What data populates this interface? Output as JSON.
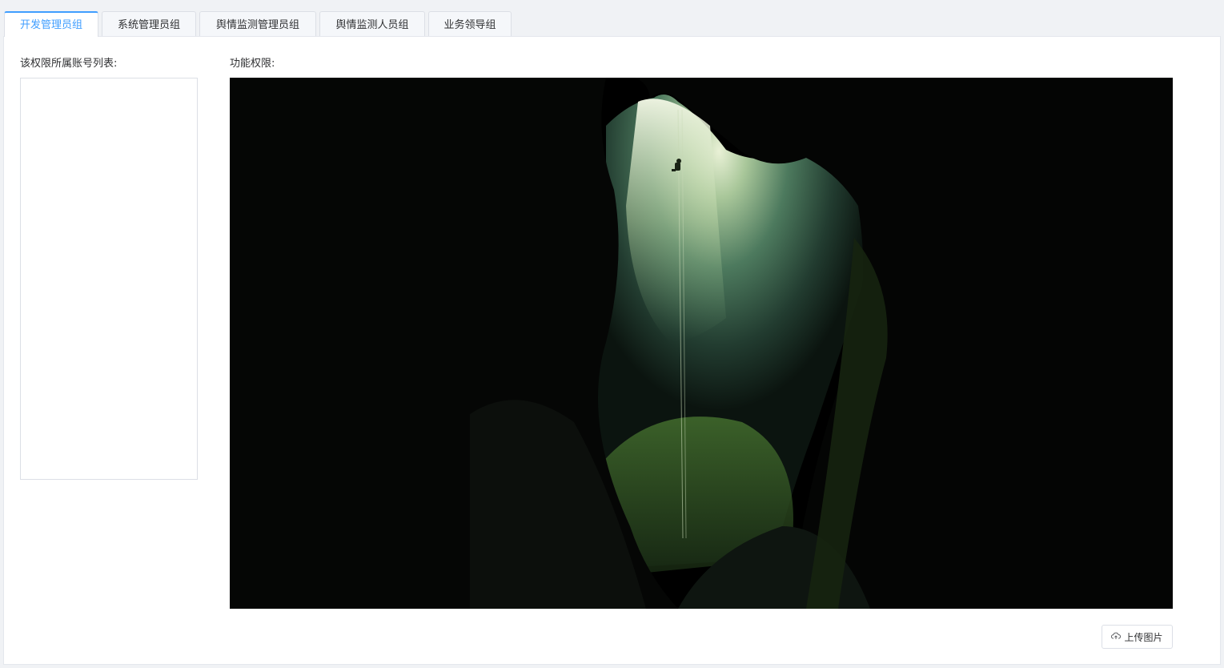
{
  "tabs": [
    {
      "label": "开发管理员组",
      "active": true
    },
    {
      "label": "系统管理员组"
    },
    {
      "label": "舆情监测管理员组"
    },
    {
      "label": "舆情监测人员组"
    },
    {
      "label": "业务领导组"
    }
  ],
  "accounts": {
    "label": "该权限所属账号列表:",
    "items": []
  },
  "functions": {
    "label": "功能权限:"
  },
  "photo": {
    "icon": "cave-photo"
  },
  "upload": {
    "label": "上传图片",
    "icon": "cloud-upload-icon"
  }
}
